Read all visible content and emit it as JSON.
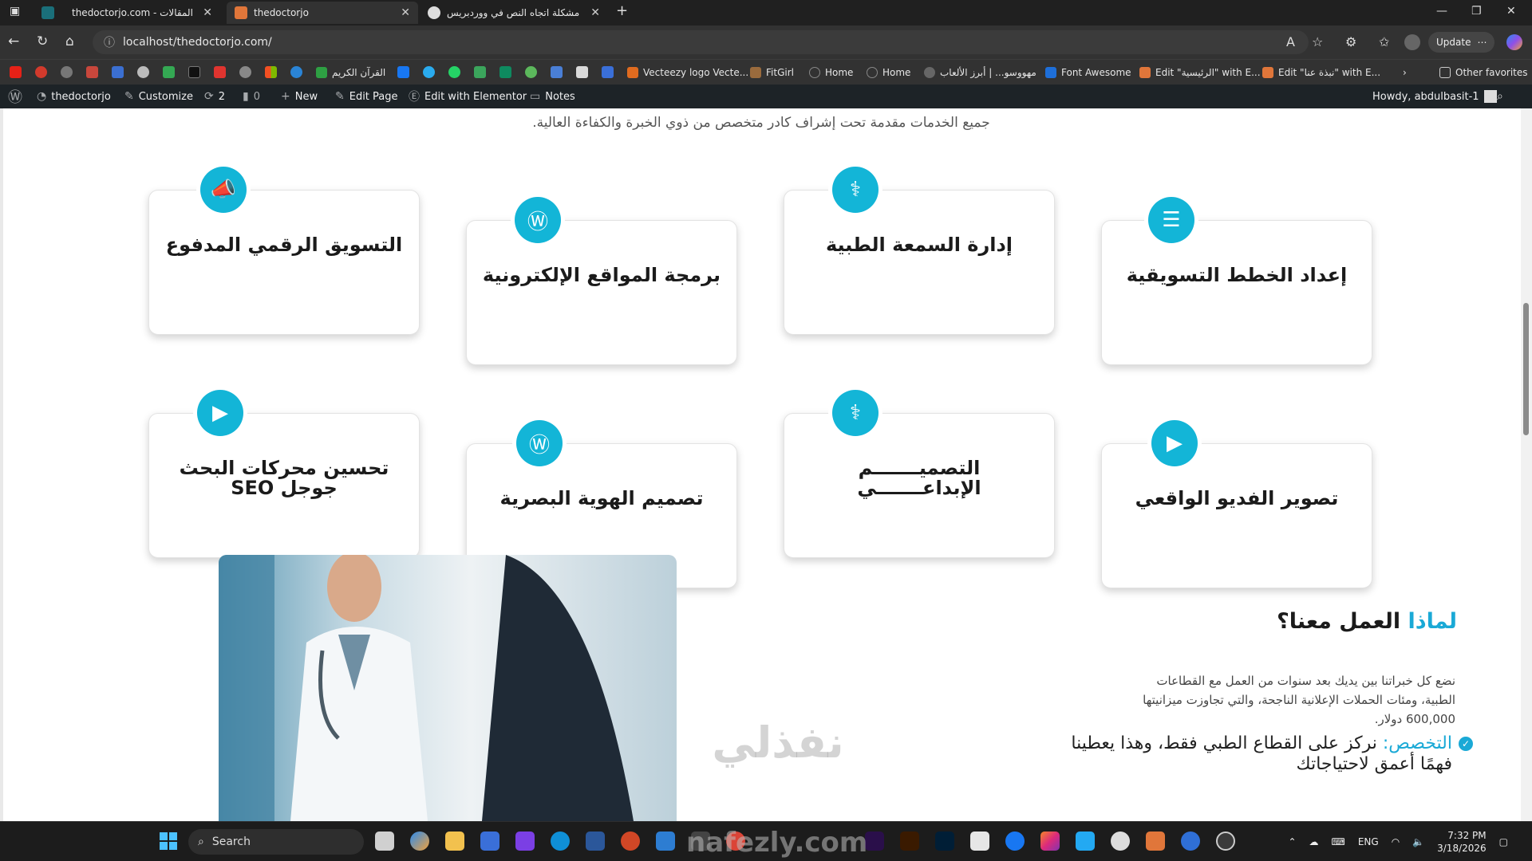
{
  "browser": {
    "tabs": [
      {
        "title": "",
        "active": false
      },
      {
        "title": "thedoctorjo.com - المقالات",
        "active": false
      },
      {
        "title": "thedoctorjo",
        "active": true
      },
      {
        "title": "مشكلة اتجاه النص في ووردبريس",
        "active": false
      }
    ],
    "new_tab": "+",
    "url": "localhost/thedoctorjo.com/",
    "update_label": "Update",
    "bookmarks": [
      {
        "label": "القرآن الكريم",
        "color": "#2ea043"
      },
      {
        "label": "Vecteezy logo Vecte...",
        "color": "#e06b1f"
      },
      {
        "label": "FitGirl",
        "color": "#9a6b3d"
      },
      {
        "label": "Home",
        "color": "#555555"
      },
      {
        "label": "Home",
        "color": "#555555"
      },
      {
        "label": "مهووسو... | أبرز الألعاب",
        "color": "#666666"
      },
      {
        "label": "Font Awesome",
        "color": "#1e6fd9"
      },
      {
        "label": "Edit \"الرئيسية\" with E...",
        "color": "#e0763a"
      },
      {
        "label": "Edit \"نبذة عنا\" with E...",
        "color": "#e0763a"
      }
    ],
    "other_favorites": "Other favorites"
  },
  "wp_admin": {
    "site": "thedoctorjo",
    "customize": "Customize",
    "updates": "2",
    "comments": "0",
    "new": "New",
    "edit_page": "Edit Page",
    "elementor": "Edit with Elementor",
    "notes": "Notes",
    "howdy": "Howdy, abdulbasit-1"
  },
  "page": {
    "subtitle": "جميع الخدمات مقدمة تحت إشراف كادر متخصص من ذوي الخبرة والكفاءة العالية.",
    "services": [
      {
        "label": "التسويق الرقمي المدفوع",
        "icon": "megaphone-icon"
      },
      {
        "label": "برمجة المواقع الإلكترونية",
        "icon": "wordpress-icon"
      },
      {
        "label": "إدارة السمعة الطبية",
        "icon": "doctor-icon"
      },
      {
        "label": "إعداد الخطط التسويقية",
        "icon": "clipboard-icon"
      },
      {
        "label": "تحسين محركات البحث جوجل SEO",
        "icon": "video-camera-icon"
      },
      {
        "label": "تصميم الهوية البصرية",
        "icon": "wordpress-icon"
      },
      {
        "label": "التصميـــــــم الإبداعـــــــي",
        "icon": "doctor-icon"
      },
      {
        "label": "تصوير الفديو الواقعي",
        "icon": "video-camera-icon"
      }
    ],
    "why": {
      "title_highlight": "لماذا",
      "title_rest": " العمل معنا؟",
      "body": "نضع كل خبراتنا بين يديك بعد سنوات من العمل مع القطاعات الطبية، ومئات الحملات الإعلانية الناجحة، والتي تجاوزت ميزانيتها 600,000 دولار.",
      "point_highlight": "التخصص:",
      "point_text": " نركز على القطاع الطبي فقط، وهذا يعطينا فهمًا أعمق لاحتياجاتك"
    },
    "watermark": "نفذلي",
    "accent_color": "#13b5d7"
  },
  "taskbar": {
    "search_label": "Search",
    "language": "ENG",
    "time": "7:32 PM",
    "date": "3/18/2026",
    "watermark": "nafezly.com"
  }
}
